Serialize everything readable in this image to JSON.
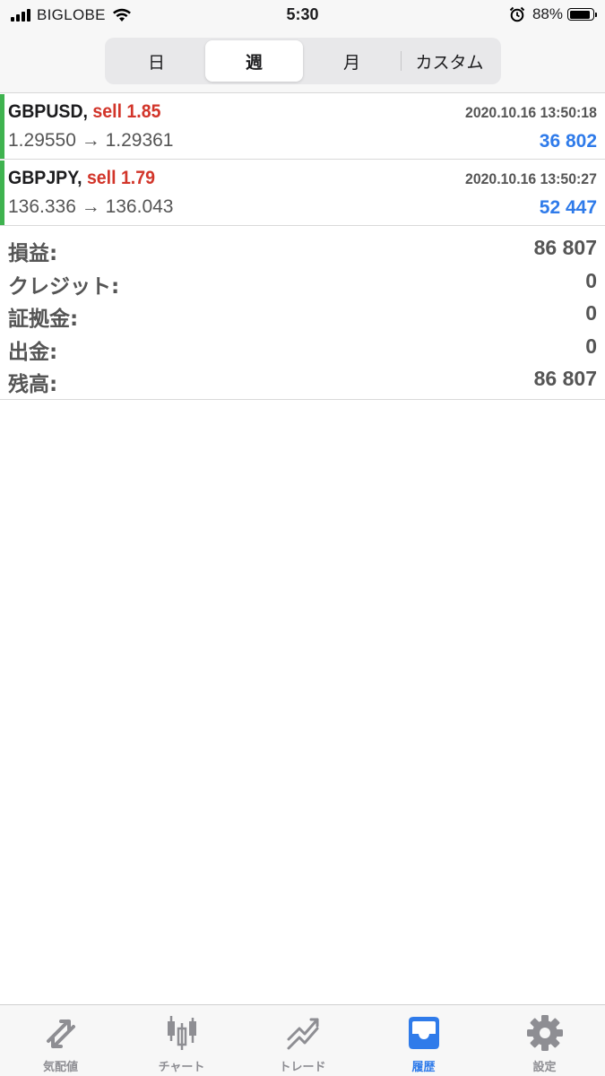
{
  "status_bar": {
    "carrier": "BIGLOBE",
    "time": "5:30",
    "battery": "88%",
    "battery_level": 0.88
  },
  "period_tabs": [
    {
      "label": "日",
      "active": false
    },
    {
      "label": "週",
      "active": true
    },
    {
      "label": "月",
      "active": false
    },
    {
      "label": "カスタム",
      "active": false
    }
  ],
  "deals": [
    {
      "symbol": "GBPUSD,",
      "type": "sell 1.85",
      "time": "2020.10.16 13:50:18",
      "prices": "1.29550 → 1.29361",
      "profit": "36 802"
    },
    {
      "symbol": "GBPJPY,",
      "type": "sell 1.79",
      "time": "2020.10.16 13:50:27",
      "prices": "136.336 → 136.043",
      "profit": "52 447"
    }
  ],
  "summary": [
    {
      "label": "損益:",
      "value": "86 807"
    },
    {
      "label": "クレジット:",
      "value": "0"
    },
    {
      "label": "証拠金:",
      "value": "0"
    },
    {
      "label": "出金:",
      "value": "0"
    },
    {
      "label": "残高:",
      "value": "86 807"
    }
  ],
  "tab_bar": [
    {
      "label": "気配値",
      "icon": "quotes-icon",
      "active": false
    },
    {
      "label": "チャート",
      "icon": "chart-icon",
      "active": false
    },
    {
      "label": "トレード",
      "icon": "trade-icon",
      "active": false
    },
    {
      "label": "履歴",
      "icon": "history-icon",
      "active": true
    },
    {
      "label": "設定",
      "icon": "settings-icon",
      "active": false
    }
  ],
  "colors": {
    "accent": "#2f7bea",
    "sell": "#d2352a",
    "deal_bar": "#3fb34f",
    "inactive_icon": "#8e8e93"
  }
}
